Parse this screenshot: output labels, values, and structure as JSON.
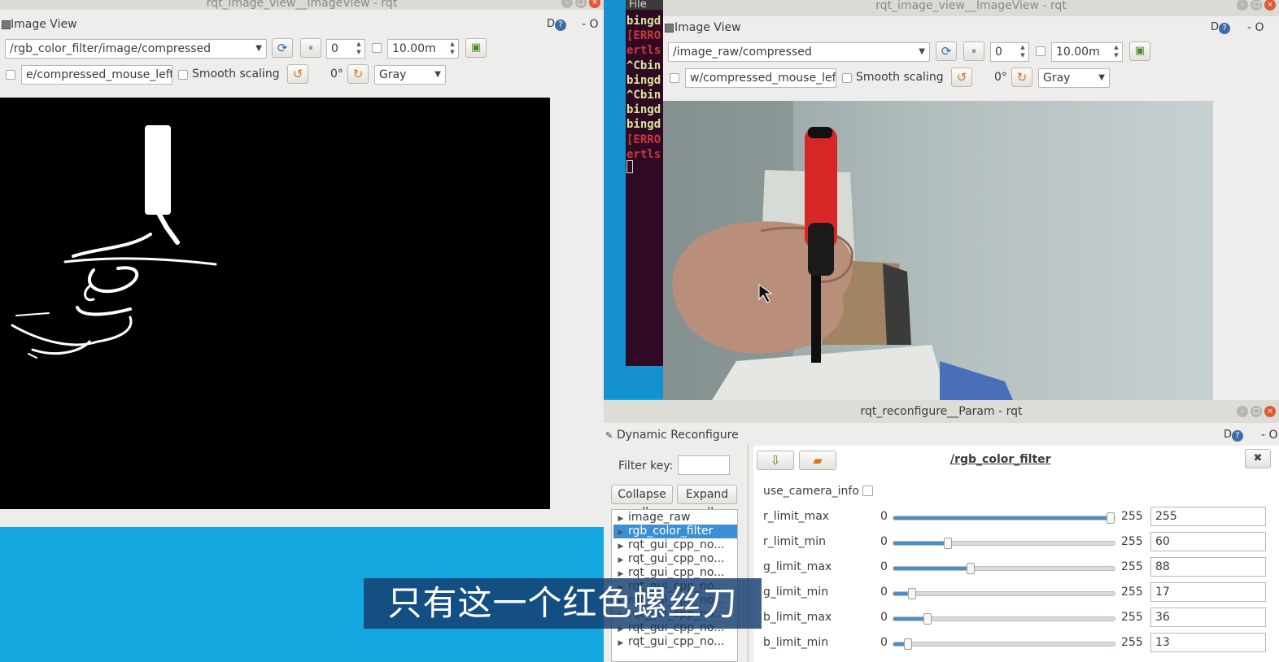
{
  "win_left": {
    "title": "rqt_image_view__ImageView - rqt",
    "plugin_title": "Image View",
    "dq": "D",
    "dash_o": "- O",
    "topic": "/rgb_color_filter/image/compressed",
    "spin_value": "0",
    "time_value": "10.00m",
    "mouse_topic": "e/compressed_mouse_left",
    "smooth_label": "Smooth scaling",
    "rotation": "0°",
    "color_mode": "Gray"
  },
  "terminal": {
    "menu": "File",
    "lines": [
      {
        "text": "bingd",
        "color": "#d8e89a"
      },
      {
        "text": "[ERRO",
        "color": "#c83a3a"
      },
      {
        "text": "ertls",
        "color": "#c83a3a"
      },
      {
        "text": "^Cbin",
        "color": "#d8e89a"
      },
      {
        "text": "bingd",
        "color": "#d8e89a"
      },
      {
        "text": "^Cbin",
        "color": "#d8e89a"
      },
      {
        "text": "bingd",
        "color": "#d8e89a"
      },
      {
        "text": "bingd",
        "color": "#d8e89a"
      },
      {
        "text": "[ERRO",
        "color": "#c83a3a"
      },
      {
        "text": "ertls",
        "color": "#c83a3a"
      }
    ]
  },
  "win_right": {
    "title": "rqt_image_view__ImageView - rqt",
    "plugin_title": "Image View",
    "dq": "D",
    "dash_o": "- O",
    "topic": "/image_raw/compressed",
    "spin_value": "0",
    "time_value": "10.00m",
    "mouse_topic": "w/compressed_mouse_left",
    "smooth_label": "Smooth scaling",
    "rotation": "0°",
    "color_mode": "Gray"
  },
  "reconf": {
    "title": "rqt_reconfigure__Param - rqt",
    "plugin_title": "Dynamic Reconfigure",
    "dq": "D",
    "dash_o": "- O",
    "filter_label": "Filter key:",
    "filter_value": "",
    "collapse_label": "Collapse all",
    "expand_label": "Expand all",
    "tree": [
      "image_raw",
      "rgb_color_filter",
      "rqt_gui_cpp_no...",
      "rqt_gui_cpp_no...",
      "rqt_gui_cpp_no...",
      "rqt_gui_cpp_no...",
      "rqt_gui_cpp_no...",
      "rqt_gui_cpp_no...",
      "rqt_gui_cpp_no...",
      "rqt_gui_cpp_no..."
    ],
    "selected_index": 1,
    "node_title": "/rgb_color_filter",
    "close_glyph": "✖",
    "use_camera_info": "use_camera_info",
    "params": [
      {
        "name": "r_limit_max",
        "min": "0",
        "max": "255",
        "value": "255",
        "frac": 1.0
      },
      {
        "name": "r_limit_min",
        "min": "0",
        "max": "255",
        "value": "60",
        "frac": 0.235
      },
      {
        "name": "g_limit_max",
        "min": "0",
        "max": "255",
        "value": "88",
        "frac": 0.345
      },
      {
        "name": "g_limit_min",
        "min": "0",
        "max": "255",
        "value": "17",
        "frac": 0.067
      },
      {
        "name": "b_limit_max",
        "min": "0",
        "max": "255",
        "value": "36",
        "frac": 0.141
      },
      {
        "name": "b_limit_min",
        "min": "0",
        "max": "255",
        "value": "13",
        "frac": 0.051
      }
    ]
  },
  "subtitle": "只有这一个红色螺丝刀",
  "colors": {
    "desktop": "#15a8e0",
    "terminal": "#300a24",
    "accent": "#4a90c8",
    "tree_select": "#3d8fd4"
  }
}
